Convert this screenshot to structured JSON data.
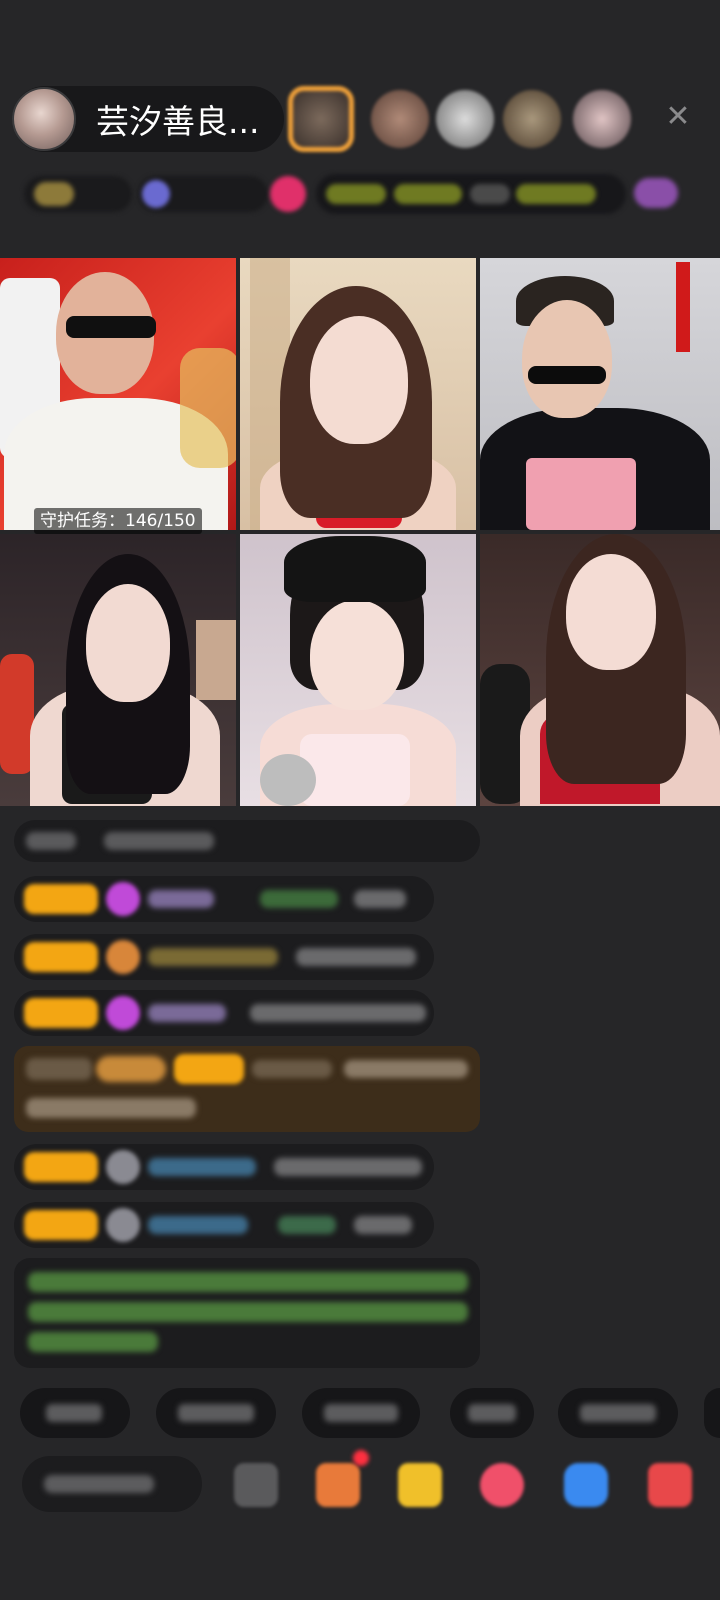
{
  "header": {
    "host_name": "芸汐善良...",
    "close_icon": "close-icon"
  },
  "grid": {
    "task_label": "守护任务：146/150"
  },
  "colors": {
    "background": "#262628",
    "level_badge": "#f3a613",
    "gift_banner": "#3d2d1a"
  }
}
